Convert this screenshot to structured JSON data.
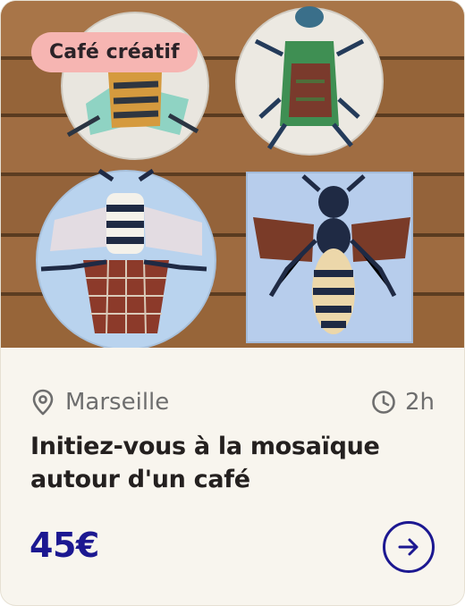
{
  "card": {
    "badge": "Café créatif",
    "image_icon": "mosaic-coasters-photo",
    "location": {
      "icon": "map-pin-icon",
      "text": "Marseille"
    },
    "duration": {
      "icon": "clock-icon",
      "text": "2h"
    },
    "title": "Initiez-vous à la mosaïque autour d'un café",
    "price": "45€",
    "action_icon": "arrow-right-icon"
  },
  "colors": {
    "card_background": "#f8f5ee",
    "badge_background": "#f6b5b2",
    "price_color": "#1c1891",
    "meta_color": "#6e6e6e"
  }
}
